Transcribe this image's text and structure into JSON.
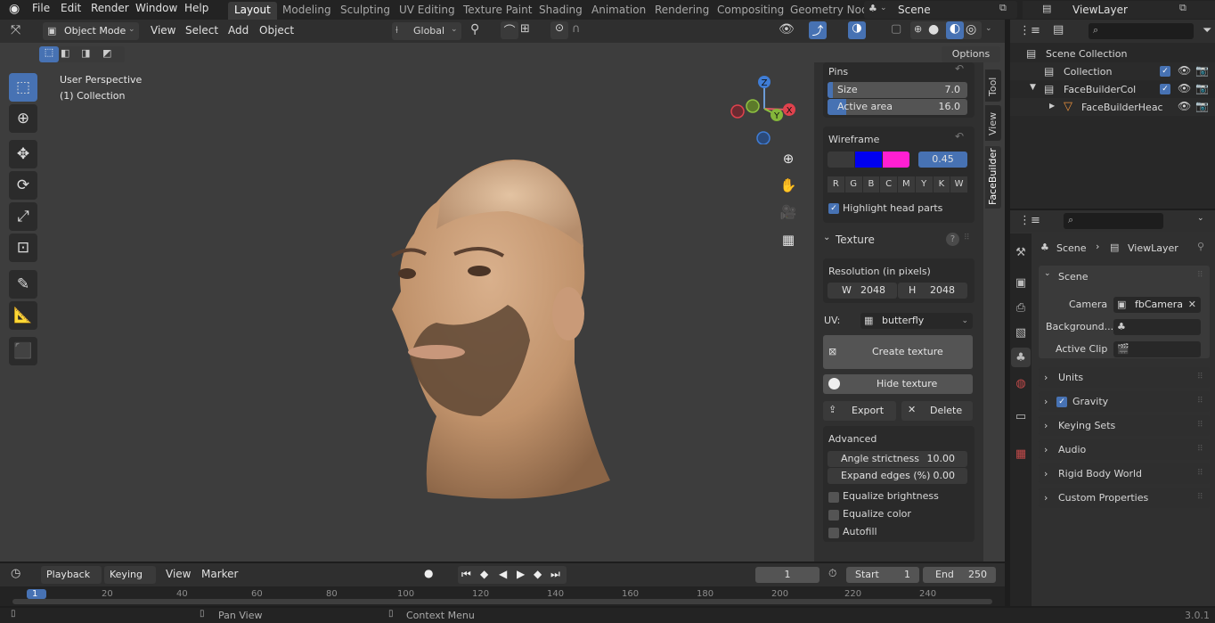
{
  "topbar": {
    "menus": [
      "File",
      "Edit",
      "Render",
      "Window",
      "Help"
    ],
    "workspaces": [
      "Layout",
      "Modeling",
      "Sculpting",
      "UV Editing",
      "Texture Paint",
      "Shading",
      "Animation",
      "Rendering",
      "Compositing",
      "Geometry Nod"
    ],
    "scene": "Scene",
    "view_layer": "ViewLayer"
  },
  "viewport": {
    "mode": "Object Mode",
    "menus": [
      "View",
      "Select",
      "Add",
      "Object"
    ],
    "orientation": "Global",
    "options": "Options",
    "perspective": "User Perspective",
    "collection": "(1) Collection",
    "gizmo": {
      "z": "Z",
      "y": "Y",
      "x": "X"
    }
  },
  "tabs": {
    "tool": "Tool",
    "view": "View",
    "facebuilder": "FaceBuilder"
  },
  "facebuilder": {
    "pins": {
      "title": "Pins",
      "size_label": "Size",
      "size": "7.0",
      "active_label": "Active area",
      "active": "16.0"
    },
    "wireframe": {
      "title": "Wireframe",
      "value": "0.45",
      "colors": [
        "#0000f0",
        "#ff1fd2"
      ],
      "letters": [
        "R",
        "G",
        "B",
        "C",
        "M",
        "Y",
        "K",
        "W"
      ],
      "highlight": "Highlight head parts"
    },
    "texture": {
      "title": "Texture",
      "resolution": "Resolution (in pixels)",
      "w_label": "W",
      "w": "2048",
      "h_label": "H",
      "h": "2048",
      "uv_label": "UV:",
      "uv": "butterfly",
      "create": "Create texture",
      "hide": "Hide texture",
      "export": "Export",
      "delete": "Delete"
    },
    "advanced": {
      "title": "Advanced",
      "angle_label": "Angle strictness",
      "angle": "10.00",
      "expand_label": "Expand edges (%)",
      "expand": "0.00",
      "eq_brightness": "Equalize brightness",
      "eq_color": "Equalize color",
      "autofill": "Autofill"
    }
  },
  "outliner": {
    "root": "Scene Collection",
    "items": [
      {
        "name": "Collection"
      },
      {
        "name": "FaceBuilderCol"
      },
      {
        "name": "FaceBuilderHeac"
      }
    ]
  },
  "properties": {
    "breadcrumb_scene": "Scene",
    "breadcrumb_layer": "ViewLayer",
    "scene_section": "Scene",
    "camera_label": "Camera",
    "camera": "fbCamera",
    "background_label": "Background...",
    "clip_label": "Active Clip",
    "sections": [
      "Units",
      "Gravity",
      "Keying Sets",
      "Audio",
      "Rigid Body World",
      "Custom Properties"
    ]
  },
  "timeline": {
    "menus": [
      "Playback",
      "Keying",
      "View",
      "Marker"
    ],
    "current": "1",
    "start_label": "Start",
    "start": "1",
    "end_label": "End",
    "end": "250",
    "ticks": [
      "1",
      "20",
      "40",
      "60",
      "80",
      "100",
      "120",
      "140",
      "160",
      "180",
      "200",
      "220",
      "240"
    ]
  },
  "statusbar": {
    "pan": "Pan View",
    "context": "Context Menu",
    "version": "3.0.1"
  }
}
